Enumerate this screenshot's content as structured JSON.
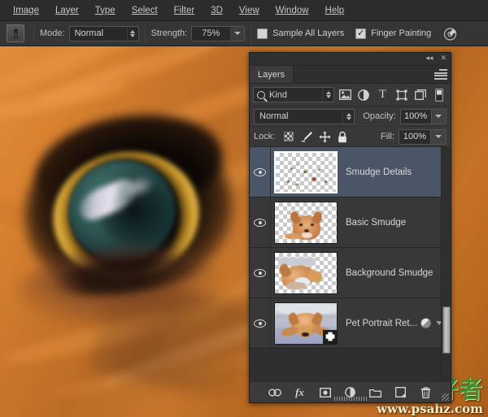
{
  "menubar": {
    "items": [
      {
        "label": "Image",
        "mnemonic": "I"
      },
      {
        "label": "Layer",
        "mnemonic": "L"
      },
      {
        "label": "Type",
        "mnemonic": "y"
      },
      {
        "label": "Select",
        "mnemonic": "S"
      },
      {
        "label": "Filter",
        "mnemonic": "t"
      },
      {
        "label": "3D",
        "mnemonic": "D"
      },
      {
        "label": "View",
        "mnemonic": "V"
      },
      {
        "label": "Window",
        "mnemonic": "W"
      },
      {
        "label": "Help",
        "mnemonic": "H"
      }
    ]
  },
  "options_bar": {
    "tool_icon": "smudge-tool-icon",
    "mode_label": "Mode:",
    "mode_value": "Normal",
    "strength_label": "Strength:",
    "strength_value": "75%",
    "sample_all_layers_label": "Sample All Layers",
    "sample_all_layers_checked": false,
    "finger_painting_label": "Finger Painting",
    "finger_painting_checked": true,
    "tablet_pressure_icon": "tablet-pressure-icon"
  },
  "canvas": {
    "subject": "close-up dog eye, orange fur, amber iris, teal pupil"
  },
  "watermark": {
    "brand": "PS 爱好者",
    "url": "www.psahz.com"
  },
  "layers_panel": {
    "titlebar": {
      "collapse_icon": "◂◂",
      "close_icon": "✕"
    },
    "tab_label": "Layers",
    "menu_icon": "panel-menu-icon",
    "filter": {
      "kind_label": "Kind",
      "icons": [
        "filter-pixel-icon",
        "filter-adjustment-icon",
        "filter-type-icon",
        "filter-shape-icon",
        "filter-smartobject-icon",
        "filter-toggle-icon"
      ]
    },
    "blend_mode": "Normal",
    "opacity_label": "Opacity:",
    "opacity_value": "100%",
    "lock_label": "Lock:",
    "lock_icons": [
      "lock-transparency-icon",
      "lock-image-icon",
      "lock-position-icon",
      "lock-all-icon"
    ],
    "fill_label": "Fill:",
    "fill_value": "100%",
    "layers": [
      {
        "name": "Smudge Details",
        "visible": true,
        "selected": true,
        "thumb": "transparent-speckles",
        "has_effects": false
      },
      {
        "name": "Basic Smudge",
        "visible": true,
        "selected": false,
        "thumb": "dog-head-cutout",
        "has_effects": false
      },
      {
        "name": "Background Smudge",
        "visible": true,
        "selected": false,
        "thumb": "dog-partial-cutout",
        "has_effects": false
      },
      {
        "name": "Pet Portrait Ret...",
        "visible": true,
        "selected": false,
        "thumb": "dog-full-photo",
        "has_effects": true,
        "smart_object": true
      }
    ],
    "bottom_toolbar": [
      {
        "name": "link-layers-icon",
        "glyph": "⚭"
      },
      {
        "name": "layer-style-fx-icon",
        "glyph": "fx"
      },
      {
        "name": "add-layer-mask-icon",
        "glyph": "▣"
      },
      {
        "name": "new-adjustment-layer-icon",
        "glyph": "◑"
      },
      {
        "name": "new-group-icon",
        "glyph": "▱"
      },
      {
        "name": "new-layer-icon",
        "glyph": "❐"
      },
      {
        "name": "delete-layer-icon",
        "glyph": "🗑"
      }
    ]
  }
}
